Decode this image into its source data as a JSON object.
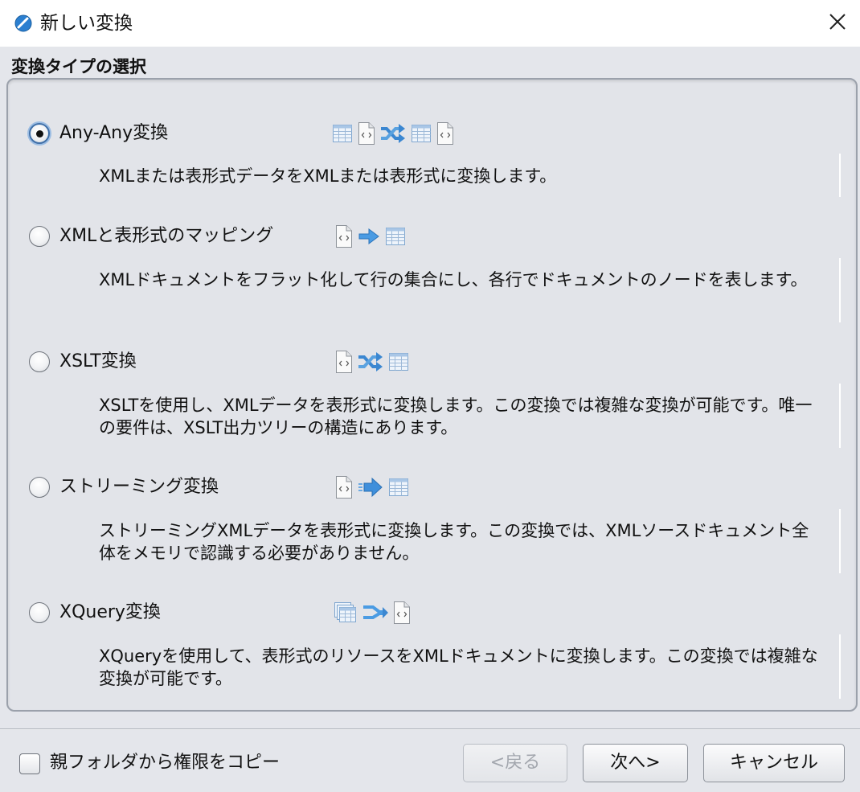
{
  "window": {
    "title": "新しい変換",
    "icon": "app-logo-icon",
    "close_icon": "close-icon"
  },
  "section": {
    "header": "変換タイプの選択"
  },
  "options": [
    {
      "label": "Any-Any変換",
      "selected": true,
      "icons": [
        "table-icon",
        "xml-document-icon",
        "shuffle-arrows-icon",
        "table-icon",
        "xml-document-icon"
      ],
      "description": "XMLまたは表形式データをXMLまたは表形式に変換します。"
    },
    {
      "label": "XMLと表形式のマッピング",
      "selected": false,
      "icons": [
        "xml-document-icon",
        "arrow-right-icon",
        "table-icon"
      ],
      "description": "XMLドキュメントをフラット化して行の集合にし、各行でドキュメントのノードを表します。"
    },
    {
      "label": "XSLT変換",
      "selected": false,
      "icons": [
        "xml-document-icon",
        "shuffle-arrows-icon",
        "table-icon"
      ],
      "description": "XSLTを使用し、XMLデータを表形式に変換します。この変換では複雑な変換が可能です。唯一の要件は、XSLT出力ツリーの構造にあります。"
    },
    {
      "label": "ストリーミング変換",
      "selected": false,
      "icons": [
        "xml-document-icon",
        "streaming-arrow-icon",
        "table-icon"
      ],
      "description": "ストリーミングXMLデータを表形式に変換します。この変換では、XMLソースドキュメント全体をメモリで認識する必要がありません。"
    },
    {
      "label": "XQuery変換",
      "selected": false,
      "icons": [
        "stacked-tables-icon",
        "double-arrow-icon",
        "xml-document-icon"
      ],
      "description": "XQueryを使用して、表形式のリソースをXMLドキュメントに変換します。この変換では複雑な変換が可能です。"
    }
  ],
  "footer": {
    "checkbox_label": "親フォルダから権限をコピー",
    "checkbox_checked": false,
    "back_label": "<戻る",
    "back_disabled": true,
    "next_label": "次へ>",
    "cancel_label": "キャンセル"
  },
  "colors": {
    "background": "#e4e6eb",
    "titlebar": "#ffffff",
    "accent_blue": "#3a8fd6"
  }
}
